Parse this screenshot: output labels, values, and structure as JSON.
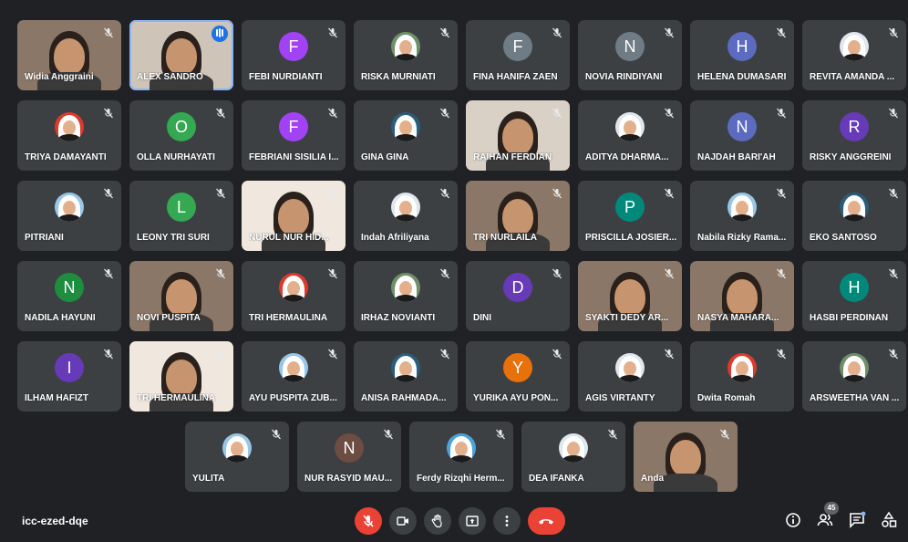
{
  "meeting": {
    "code": "icc-ezed-dqe",
    "participants_count": "45"
  },
  "colors": {
    "accent": "#1a73e8",
    "end_call": "#ea4335",
    "tile_bg": "#3c4043"
  },
  "tiles": [
    {
      "name": "Widia Anggraini",
      "kind": "video",
      "status": "muted"
    },
    {
      "name": "ALEX SANDRO",
      "kind": "video",
      "status": "speaking"
    },
    {
      "name": "FEBI NURDIANTI",
      "kind": "letter",
      "letter": "F",
      "color": "#a142f4",
      "status": "muted"
    },
    {
      "name": "RISKA MURNIATI",
      "kind": "photo",
      "status": "muted"
    },
    {
      "name": "FINA HANIFA ZAEN",
      "kind": "letter",
      "letter": "F",
      "color": "#6f7c85",
      "status": "muted"
    },
    {
      "name": "NOVIA RINDIYANI",
      "kind": "letter",
      "letter": "N",
      "color": "#6f7c85",
      "status": "muted"
    },
    {
      "name": "HELENA DUMASARI",
      "kind": "letter",
      "letter": "H",
      "color": "#5c6bc0",
      "status": "muted"
    },
    {
      "name": "REVITA AMANDA ...",
      "kind": "photo",
      "status": "muted"
    },
    {
      "name": "TRIYA DAMAYANTI",
      "kind": "photo",
      "status": "muted"
    },
    {
      "name": "OLLA NURHAYATI",
      "kind": "letter",
      "letter": "O",
      "color": "#34a853",
      "status": "muted"
    },
    {
      "name": "FEBRIANI SISILIA I...",
      "kind": "letter",
      "letter": "F",
      "color": "#a142f4",
      "status": "muted"
    },
    {
      "name": "GINA GINA",
      "kind": "photo",
      "status": "muted"
    },
    {
      "name": "RAIHAN FERDIAN",
      "kind": "video",
      "status": "muted"
    },
    {
      "name": "ADITYA DHARMA...",
      "kind": "photo",
      "status": "muted"
    },
    {
      "name": "NAJDAH BARI'AH",
      "kind": "letter",
      "letter": "N",
      "color": "#5c6bc0",
      "status": "muted"
    },
    {
      "name": "RISKY ANGGREINI",
      "kind": "letter",
      "letter": "R",
      "color": "#673ab7",
      "status": "muted"
    },
    {
      "name": "PITRIANI",
      "kind": "photo",
      "status": "muted"
    },
    {
      "name": "LEONY TRI SURI",
      "kind": "letter",
      "letter": "L",
      "color": "#34a853",
      "status": "muted"
    },
    {
      "name": "NURUL NUR HID...",
      "kind": "video",
      "status": "muted"
    },
    {
      "name": "Indah Afriliyana",
      "kind": "photo",
      "status": "muted"
    },
    {
      "name": "TRI NURLAILA",
      "kind": "video",
      "status": "muted"
    },
    {
      "name": "PRISCILLA JOSIER...",
      "kind": "letter",
      "letter": "P",
      "color": "#00897b",
      "status": "muted"
    },
    {
      "name": "Nabila Rizky Rama...",
      "kind": "photo",
      "status": "muted"
    },
    {
      "name": "EKO SANTOSO",
      "kind": "photo",
      "status": "muted"
    },
    {
      "name": "NADILA HAYUNI",
      "kind": "letter",
      "letter": "N",
      "color": "#1e8e3e",
      "status": "muted"
    },
    {
      "name": "NOVI PUSPITA",
      "kind": "video",
      "status": "muted"
    },
    {
      "name": "TRI HERMAULINA",
      "kind": "photo",
      "status": "muted"
    },
    {
      "name": "IRHAZ NOVIANTI",
      "kind": "photo",
      "status": "muted"
    },
    {
      "name": "DINI",
      "kind": "letter",
      "letter": "D",
      "color": "#673ab7",
      "status": "muted"
    },
    {
      "name": "SYAKTI DEDY AR...",
      "kind": "video",
      "status": "muted"
    },
    {
      "name": "NASYA MAHARA...",
      "kind": "video",
      "status": "muted"
    },
    {
      "name": "HASBI PERDINAN",
      "kind": "letter",
      "letter": "H",
      "color": "#00897b",
      "status": "muted"
    },
    {
      "name": "ILHAM HAFIZT",
      "kind": "letter",
      "letter": "I",
      "color": "#673ab7",
      "status": "muted"
    },
    {
      "name": "TRI HERMAULINA",
      "kind": "video",
      "status": "muted"
    },
    {
      "name": "AYU PUSPITA ZUB...",
      "kind": "photo",
      "status": "muted"
    },
    {
      "name": "ANISA RAHMADA...",
      "kind": "photo",
      "status": "muted"
    },
    {
      "name": "YURIKA AYU PON...",
      "kind": "letter",
      "letter": "Y",
      "color": "#e8710a",
      "status": "muted"
    },
    {
      "name": "AGIS VIRTANTY",
      "kind": "photo",
      "status": "muted"
    },
    {
      "name": "Dwita Romah",
      "kind": "photo",
      "status": "muted"
    },
    {
      "name": "ARSWEETHA VAN ...",
      "kind": "photo",
      "status": "muted"
    },
    {
      "name": "YULITA",
      "kind": "photo",
      "status": "muted"
    },
    {
      "name": "NUR RASYID MAU...",
      "kind": "letter",
      "letter": "N",
      "color": "#6d4c41",
      "status": "muted"
    },
    {
      "name": "Ferdy Rizqhi Herm...",
      "kind": "photo",
      "status": "muted"
    },
    {
      "name": "DEA IFANKA",
      "kind": "photo",
      "status": "muted"
    },
    {
      "name": "Anda",
      "kind": "video",
      "status": "muted"
    }
  ],
  "controls": {
    "mic": "mic-off-icon",
    "camera": "camera-icon",
    "hand": "raise-hand-icon",
    "present": "present-icon",
    "more": "more-options-icon",
    "end": "end-call-icon",
    "info": "info-icon",
    "people": "people-icon",
    "chat": "chat-icon",
    "activities": "activities-icon"
  }
}
